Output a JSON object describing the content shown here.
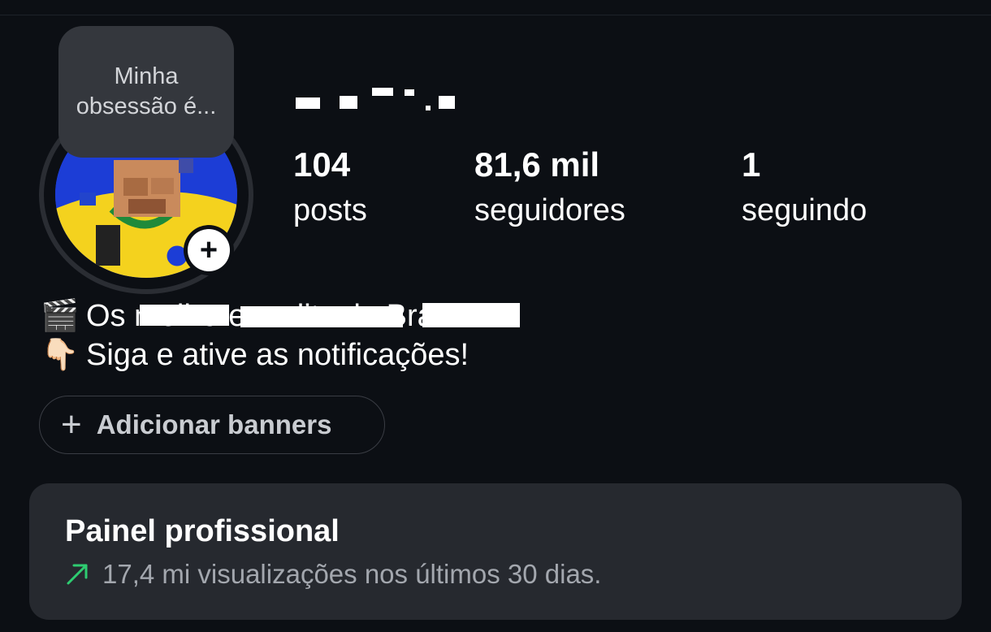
{
  "profile": {
    "note": "Minha obsessão é...",
    "stats": [
      {
        "value": "104",
        "label": "posts"
      },
      {
        "value": "81,6 mil",
        "label": "seguidores"
      },
      {
        "value": "1",
        "label": "seguindo"
      }
    ],
    "bio": {
      "line1_emoji": "🎬",
      "line1_text": "Os melhores edits do Brasil",
      "line2_emoji": "👇🏻",
      "line2_text": "Siga e ative as notificações!"
    },
    "add_banners_label": "Adicionar banners"
  },
  "dashboard": {
    "title": "Painel profissional",
    "subtitle": "17,4 mi visualizações nos últimos 30 dias.",
    "trend_color": "#2ecc71"
  },
  "icons": {
    "add_story": "plus-icon",
    "add_banner": "plus-icon",
    "trend": "trending-up-arrow-icon"
  },
  "colors": {
    "background": "#0c0f14",
    "panel": "#26292f",
    "note_bubble": "#34373d"
  }
}
